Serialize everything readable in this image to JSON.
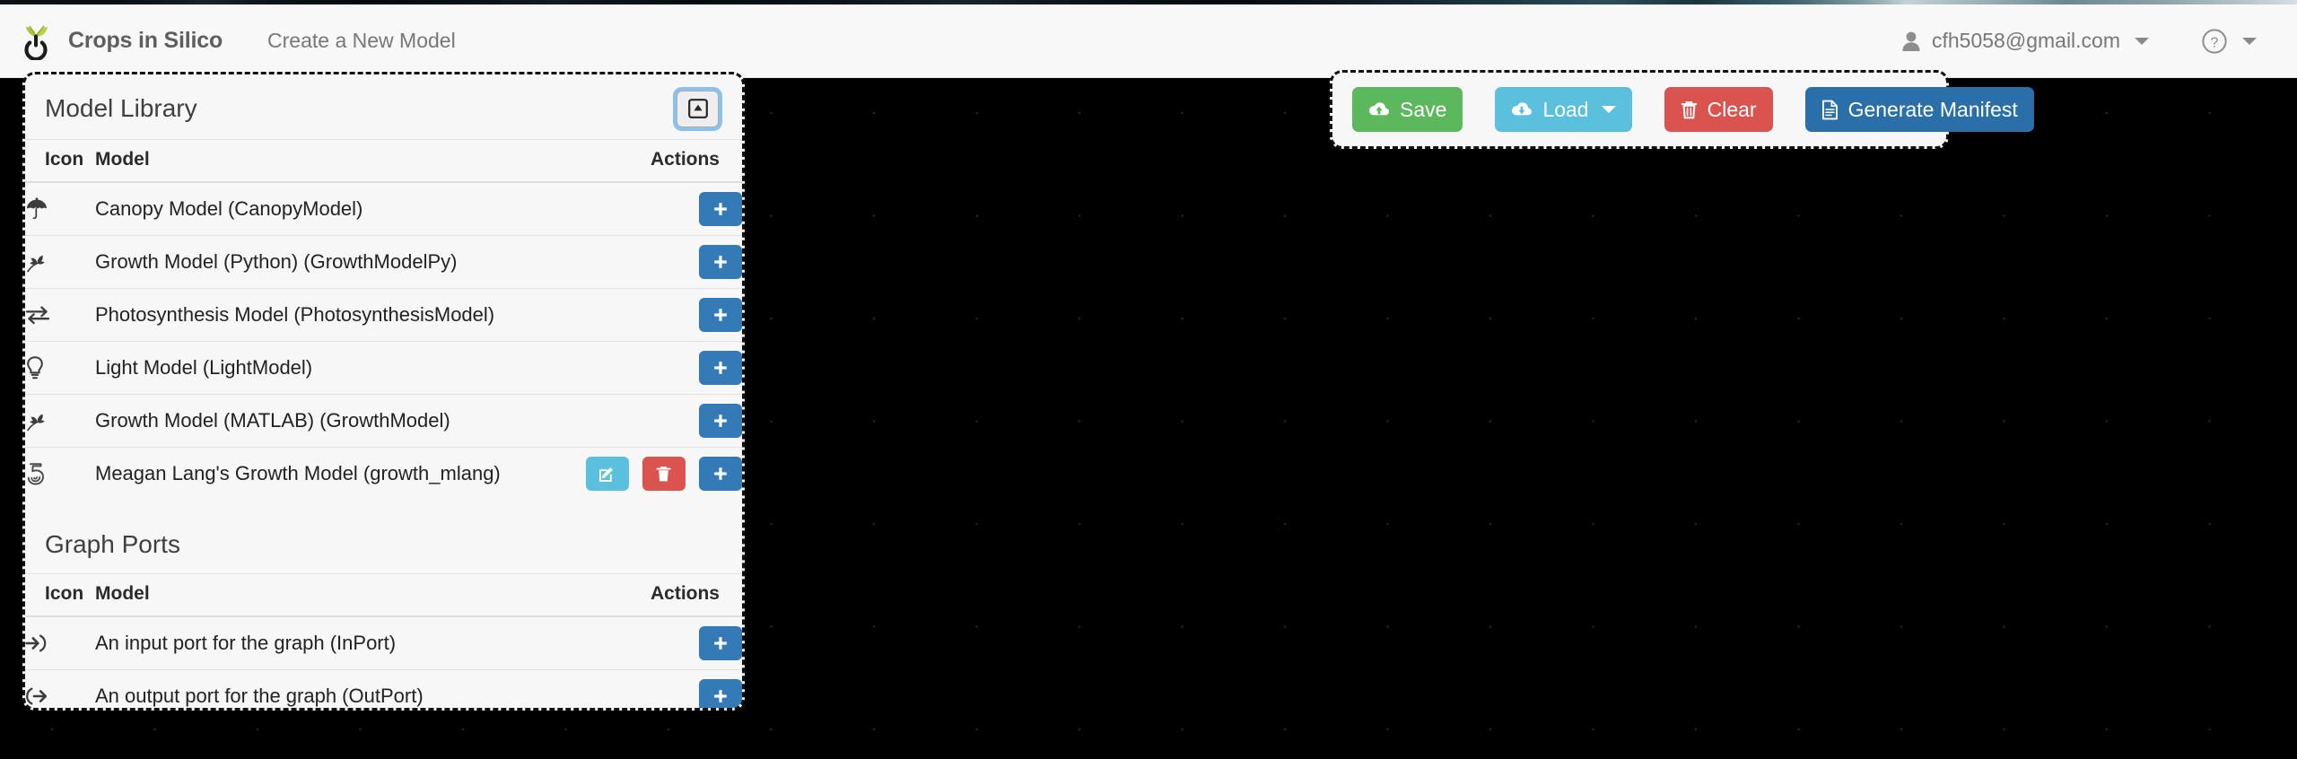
{
  "app": {
    "brand": "Crops in Silico",
    "nav_link": "Create a New Model",
    "logo_icon": "seedling-power-logo"
  },
  "navbar": {
    "user_email": "cfh5058@gmail.com",
    "user_icon": "user-icon",
    "user_caret_icon": "caret-down-icon",
    "help_icon": "question-circle-icon",
    "help_caret_icon": "caret-down-icon"
  },
  "library_panel": {
    "title": "Model Library",
    "collapse_icon": "caret-square-up-icon",
    "columns": {
      "icon": "Icon",
      "model": "Model",
      "actions": "Actions"
    },
    "rows": [
      {
        "icon": "umbrella-icon",
        "label": "Canopy Model (CanopyModel)",
        "actions": [
          {
            "name": "add-button",
            "icon": "plus-icon",
            "color": "#337ab7"
          }
        ]
      },
      {
        "icon": "seedling-icon",
        "label": "Growth Model (Python) (GrowthModelPy)",
        "actions": [
          {
            "name": "add-button",
            "icon": "plus-icon",
            "color": "#337ab7"
          }
        ]
      },
      {
        "icon": "exchange-arrows-icon",
        "label": "Photosynthesis Model (PhotosynthesisModel)",
        "actions": [
          {
            "name": "add-button",
            "icon": "plus-icon",
            "color": "#337ab7"
          }
        ]
      },
      {
        "icon": "lightbulb-icon",
        "label": "Light Model (LightModel)",
        "actions": [
          {
            "name": "add-button",
            "icon": "plus-icon",
            "color": "#337ab7"
          }
        ]
      },
      {
        "icon": "seedling-icon",
        "label": "Growth Model (MATLAB) (GrowthModel)",
        "actions": [
          {
            "name": "add-button",
            "icon": "plus-icon",
            "color": "#337ab7"
          }
        ]
      },
      {
        "icon": "spiral-five-icon",
        "label": "Meagan Lang's Growth Model (growth_mlang)",
        "actions": [
          {
            "name": "edit-button",
            "icon": "pencil-square-icon",
            "color": "#5bc0de"
          },
          {
            "name": "delete-button",
            "icon": "trash-icon",
            "color": "#d9534f"
          },
          {
            "name": "add-button",
            "icon": "plus-icon",
            "color": "#337ab7"
          }
        ]
      }
    ]
  },
  "graph_ports": {
    "title": "Graph Ports",
    "columns": {
      "icon": "Icon",
      "model": "Model",
      "actions": "Actions"
    },
    "rows": [
      {
        "icon": "sign-in-arrow-icon",
        "label": "An input port for the graph (InPort)",
        "actions": [
          {
            "name": "add-button",
            "icon": "plus-icon",
            "color": "#337ab7"
          }
        ]
      },
      {
        "icon": "sign-out-arrow-icon",
        "label": "An output port for the graph (OutPort)",
        "actions": [
          {
            "name": "add-button",
            "icon": "plus-icon",
            "color": "#337ab7"
          }
        ]
      }
    ]
  },
  "toolbar": {
    "save_label": "Save",
    "save_icon": "cloud-upload-icon",
    "save_color": "#5cb85c",
    "load_label": "Load",
    "load_icon": "cloud-download-icon",
    "load_caret_icon": "caret-down-icon",
    "load_color": "#5bc0de",
    "clear_label": "Clear",
    "clear_icon": "trash-icon",
    "clear_color": "#d9534f",
    "manifest_label": "Generate Manifest",
    "manifest_icon": "file-text-icon",
    "manifest_color": "#2b6fa8"
  },
  "canvas": {
    "background_color": "#000000",
    "grid": "dotted"
  }
}
